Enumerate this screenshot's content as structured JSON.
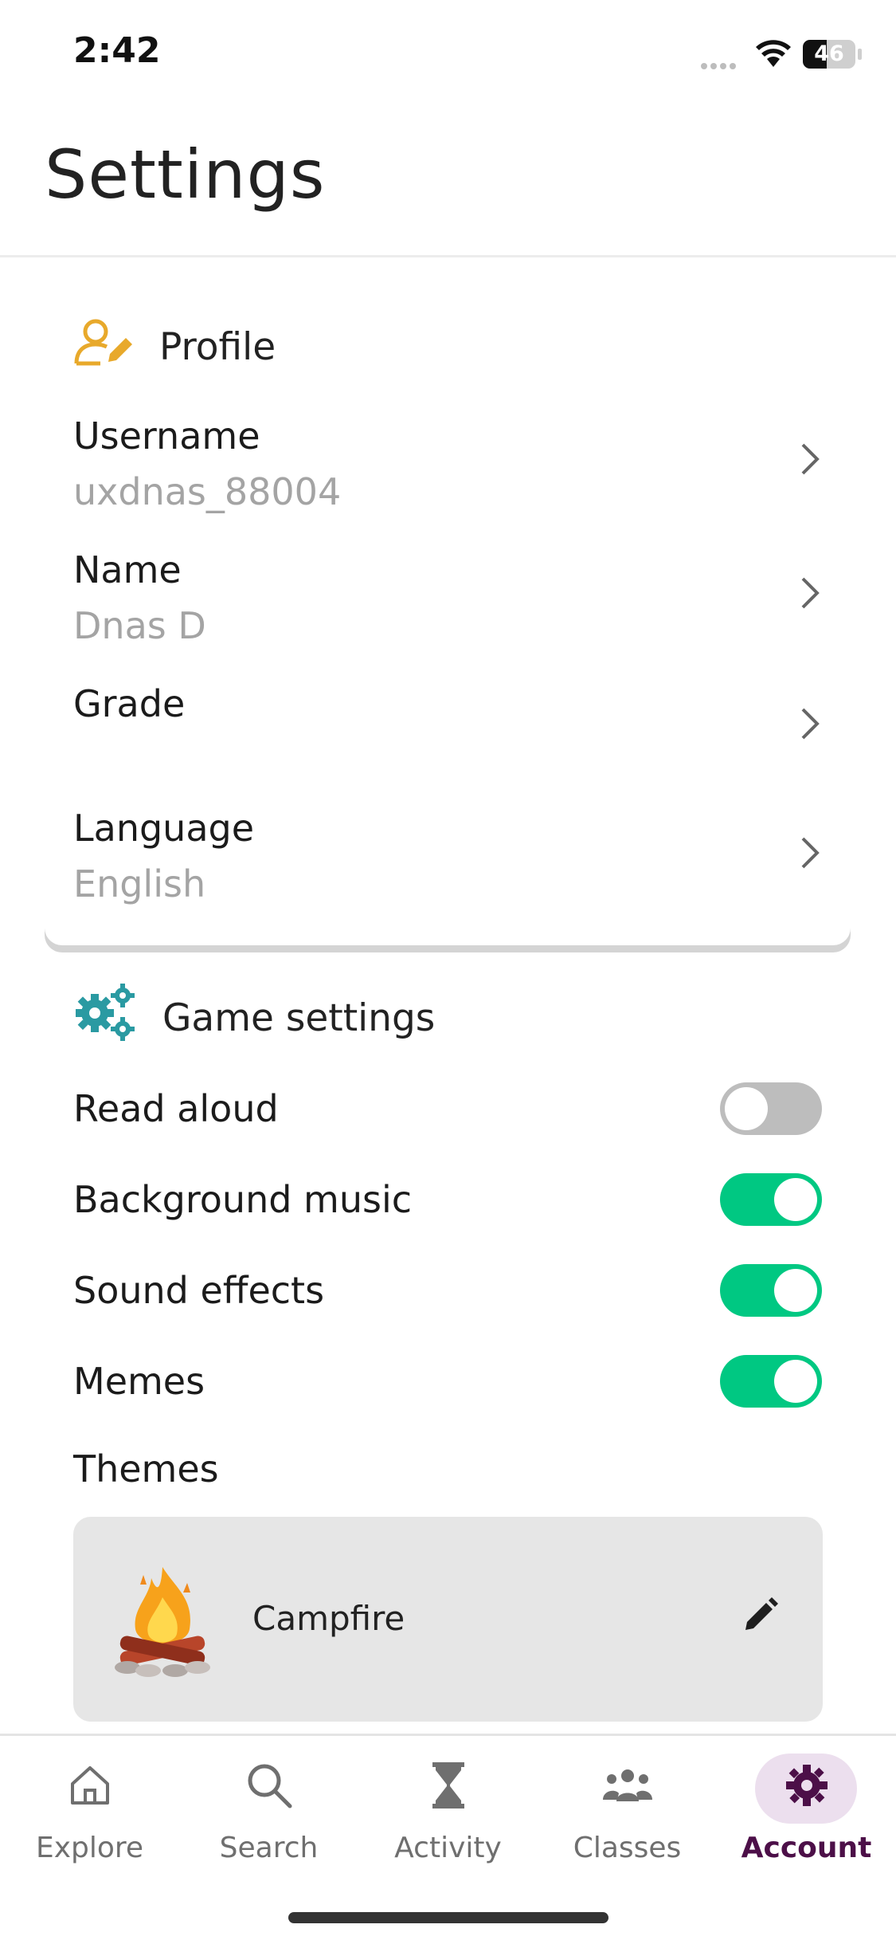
{
  "status_bar": {
    "time": "2:42",
    "battery": "46"
  },
  "header": {
    "title": "Settings"
  },
  "profile": {
    "heading": "Profile",
    "rows": [
      {
        "label": "Username",
        "value": "uxdnas_88004"
      },
      {
        "label": "Name",
        "value": "Dnas D"
      },
      {
        "label": "Grade",
        "value": ""
      },
      {
        "label": "Language",
        "value": "English"
      }
    ]
  },
  "game_settings": {
    "heading": "Game settings",
    "toggles": [
      {
        "label": "Read aloud",
        "on": false
      },
      {
        "label": "Background music",
        "on": true
      },
      {
        "label": "Sound effects",
        "on": true
      },
      {
        "label": "Memes",
        "on": true
      }
    ],
    "themes_label": "Themes",
    "theme": {
      "name": "Campfire",
      "icon": "campfire-icon"
    }
  },
  "nav": {
    "items": [
      {
        "label": "Explore",
        "icon": "home-icon",
        "active": false
      },
      {
        "label": "Search",
        "icon": "search-icon",
        "active": false
      },
      {
        "label": "Activity",
        "icon": "hourglass-icon",
        "active": false
      },
      {
        "label": "Classes",
        "icon": "people-icon",
        "active": false
      },
      {
        "label": "Account",
        "icon": "gear-icon",
        "active": true
      }
    ]
  },
  "colors": {
    "accent_green": "#00c882",
    "active_nav": "#4c0f48",
    "profile_icon": "#e8a92b",
    "gear_icon": "#2a9aa2"
  }
}
